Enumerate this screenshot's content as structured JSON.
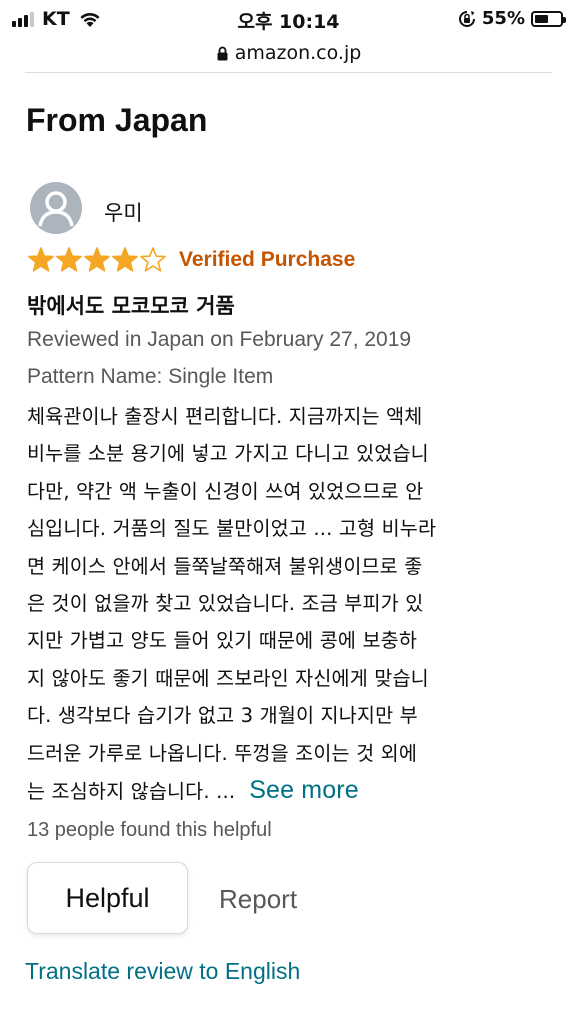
{
  "status_bar": {
    "carrier": "KT",
    "time": "오후 10:14",
    "battery_percent": "55%",
    "battery_level": 0.55
  },
  "browser": {
    "url": "amazon.co.jp"
  },
  "section": {
    "title": "From Japan"
  },
  "review": {
    "reviewer_name": "우미",
    "rating": 4,
    "rating_max": 5,
    "verified_label": "Verified Purchase",
    "title": "밖에서도 모코모코 거품",
    "date": "Reviewed in Japan on February 27, 2019",
    "pattern": "Pattern Name: Single Item",
    "body_lines": [
      "체육관이나 출장시 편리합니다. 지금까지는 액체",
      "비누를 소분 용기에 넣고 가지고 다니고 있었습니",
      "다만, 약간 액 누출이 신경이 쓰여 있었으므로 안",
      "심입니다. 거품의 질도 불만이었고 ... 고형 비누라",
      "면 케이스 안에서 들쭉날쭉해져 불위생이므로 좋",
      "은 것이 없을까 찾고 있었습니다. 조금 부피가 있",
      "지만 가볍고 양도 들어 있기 때문에 콩에 보충하",
      "지 않아도 좋기 때문에 즈보라인 자신에게 맞습니",
      "다. 생각보다 습기가 없고 3 개월이 지나지만 부",
      "드러운 가루로 나옵니다. 뚜껑을 조이는 것 외에",
      "는 조심하지 않습니다. ..."
    ],
    "see_more": "See more",
    "helpful_count": "13 people found this helpful",
    "helpful_button": "Helpful",
    "report_link": "Report",
    "translate_link": "Translate review to English"
  },
  "colors": {
    "star": "#f5a623",
    "verified": "#c45500",
    "link": "#007185",
    "secondary_text": "#565959"
  }
}
